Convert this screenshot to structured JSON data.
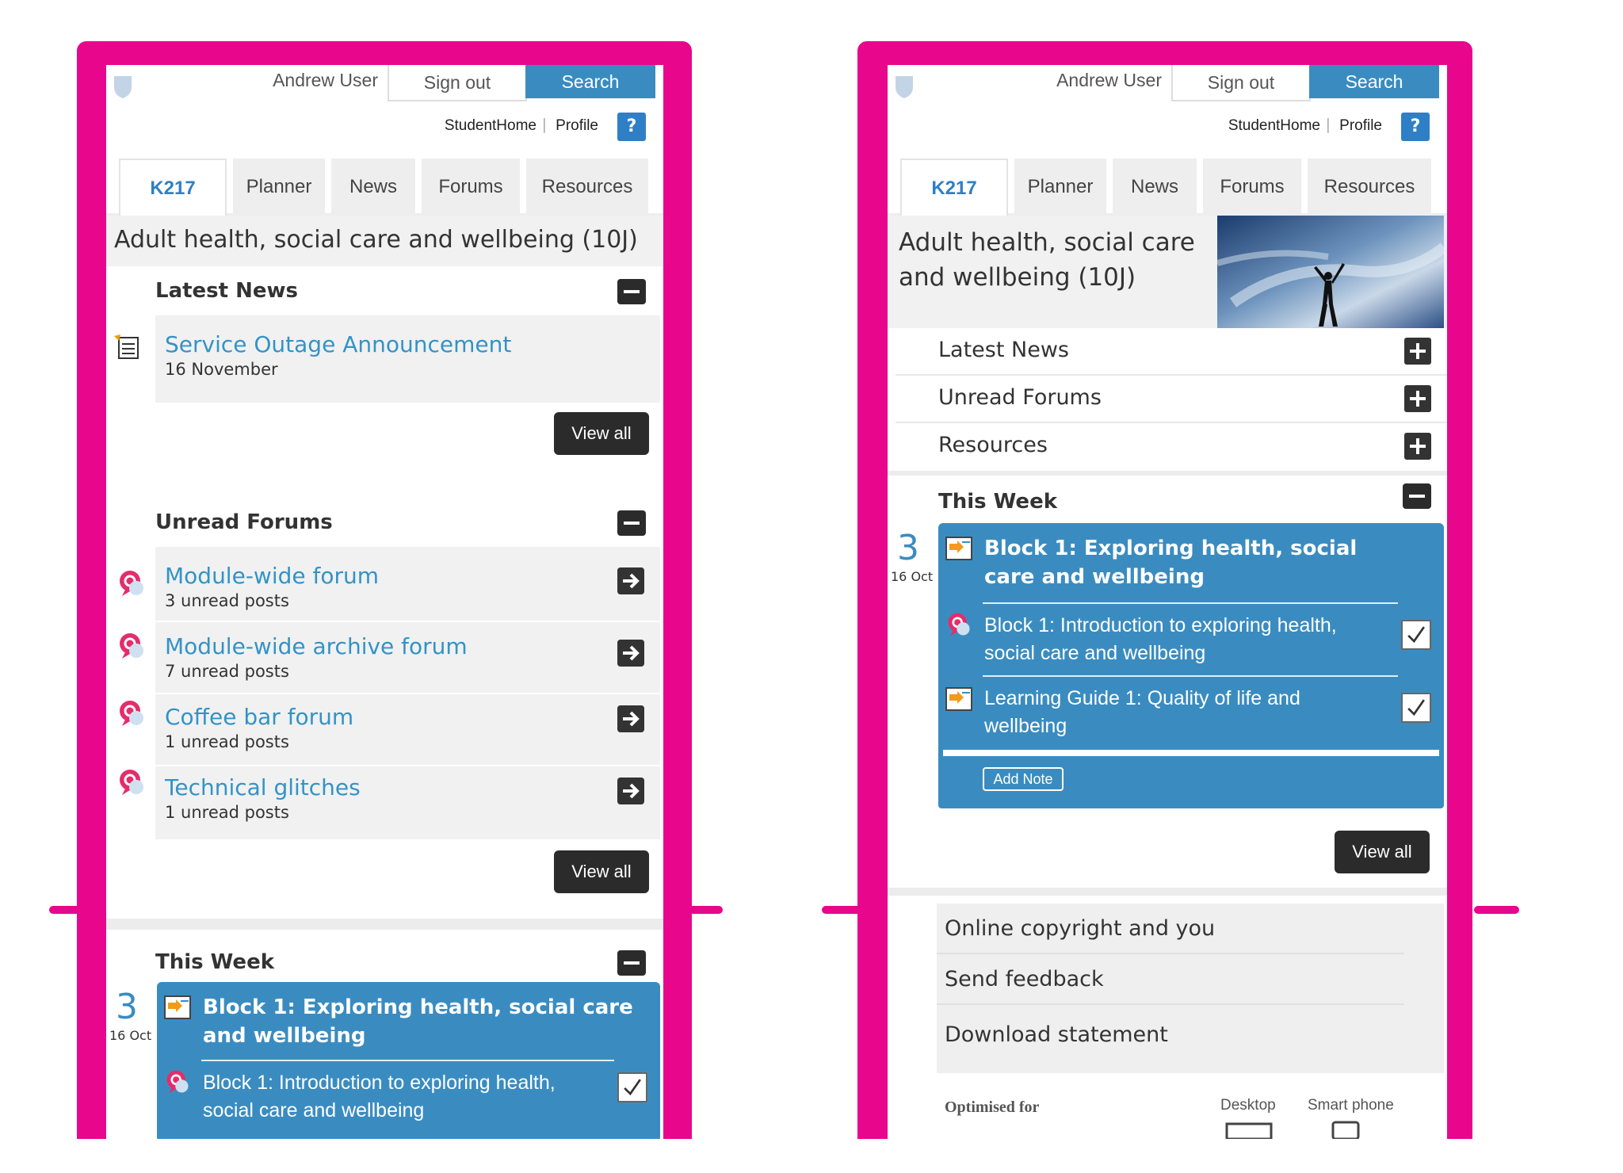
{
  "common": {
    "user_name": "Andrew User",
    "sign_out": "Sign out",
    "search": "Search",
    "student_home": "StudentHome",
    "separator": "|",
    "profile": "Profile",
    "help": "?",
    "tabs": [
      "K217",
      "Planner",
      "News",
      "Forums",
      "Resources"
    ],
    "module_title": "Adult health, social care and wellbeing (10J)",
    "view_all": "View all"
  },
  "left": {
    "latest_news": {
      "heading": "Latest News",
      "item_title": "Service Outage Announcement",
      "item_date": "16 November"
    },
    "unread_forums": {
      "heading": "Unread Forums",
      "items": [
        {
          "title": "Module-wide forum",
          "sub": "3 unread posts"
        },
        {
          "title": "Module-wide archive forum",
          "sub": "7 unread posts"
        },
        {
          "title": "Coffee bar forum",
          "sub": "1 unread posts"
        },
        {
          "title": "Technical glitches",
          "sub": "1 unread posts"
        }
      ]
    },
    "this_week": {
      "heading": "This Week",
      "week_number": "3",
      "week_date": "16 Oct",
      "block_title": "Block 1: Exploring health, social care and wellbeing",
      "item": "Block 1: Introduction to exploring health, social care and wellbeing"
    }
  },
  "right": {
    "module_title_line1": "Adult health, social care",
    "module_title_line2": "and wellbeing (10J)",
    "collapsed_sections": [
      "Latest News",
      "Unread Forums",
      "Resources"
    ],
    "this_week": {
      "heading": "This Week",
      "week_number": "3",
      "week_date": "16 Oct",
      "block_title": "Block 1: Exploring health, social care and wellbeing",
      "items": [
        "Block 1: Introduction to exploring health, social care and wellbeing",
        "Learning Guide 1: Quality of life and wellbeing"
      ],
      "add_note": "Add Note"
    },
    "footer_links": [
      "Online copyright and you",
      "Send feedback",
      "Download statement"
    ],
    "optimised_for": "Optimised for",
    "desktop": "Desktop",
    "smart_phone": "Smart phone"
  },
  "colors": {
    "frame": "#e8068c",
    "accent_blue": "#3a8cc0",
    "link_blue": "#3393c6",
    "dark_button": "#2b2b2b"
  }
}
